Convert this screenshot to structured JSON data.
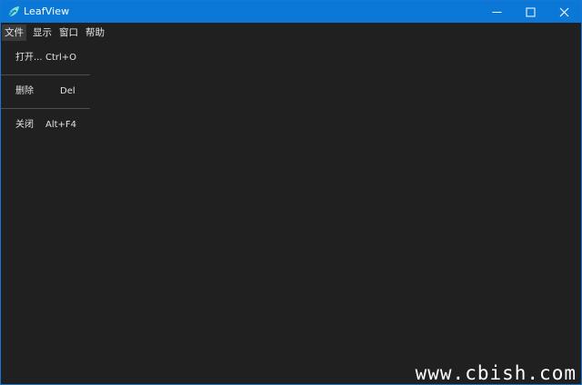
{
  "window": {
    "title": "LeafView",
    "icon": "leaf-icon",
    "controls": {
      "minimize_icon": "minimize-icon",
      "maximize_icon": "maximize-icon",
      "close_icon": "close-icon"
    }
  },
  "menubar": {
    "items": [
      {
        "label": "文件",
        "active": true
      },
      {
        "label": "显示",
        "active": false
      },
      {
        "label": "窗口",
        "active": false
      },
      {
        "label": "帮助",
        "active": false
      }
    ]
  },
  "file_menu": {
    "items": [
      {
        "label": "打开...",
        "shortcut": "Ctrl+O"
      },
      {
        "label": "删除",
        "shortcut": "Del"
      },
      {
        "label": "关闭",
        "shortcut": "Alt+F4"
      }
    ]
  },
  "watermark": {
    "text": "www.cbish.com"
  },
  "colors": {
    "titlebar": "#0b78d7",
    "background": "#202020",
    "menu_active": "#3a3a3a",
    "separator": "#4e4e4e",
    "text": "#e4e4e4"
  }
}
